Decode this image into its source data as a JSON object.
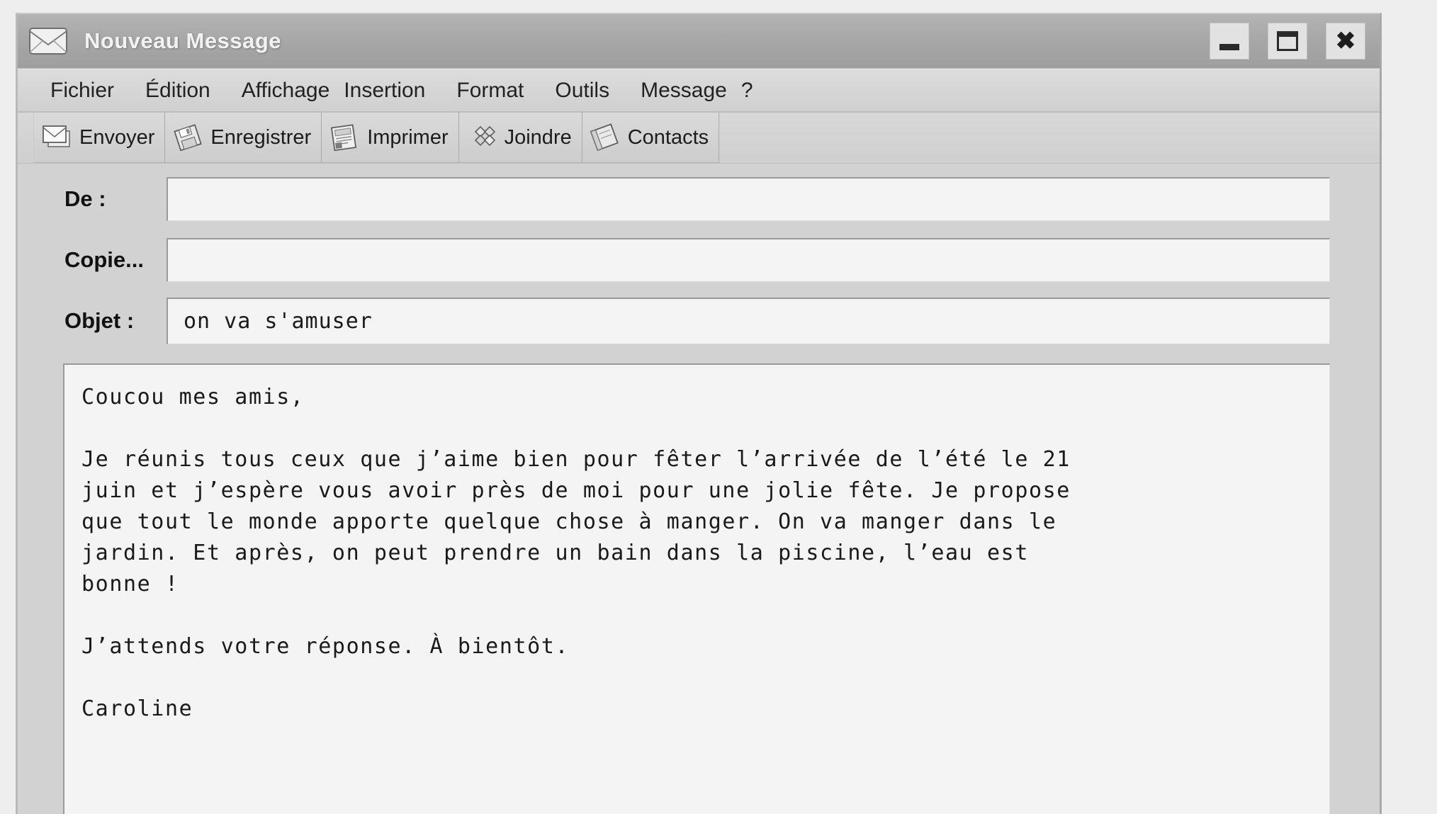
{
  "window": {
    "title": "Nouveau Message",
    "title_icon": "envelope-icon",
    "controls": {
      "minimize": "minimize-icon",
      "maximize": "maximize-icon",
      "close": "close-icon"
    }
  },
  "menubar": {
    "items": [
      {
        "label": "Fichier"
      },
      {
        "label": "Édition"
      },
      {
        "label": "Affichage"
      },
      {
        "label": "Insertion"
      },
      {
        "label": "Format"
      },
      {
        "label": "Outils"
      },
      {
        "label": "Message"
      },
      {
        "label": "?"
      }
    ]
  },
  "toolbar": {
    "buttons": [
      {
        "label": "Envoyer",
        "icon": "envelope-icon"
      },
      {
        "label": "Enregistrer",
        "icon": "floppy-disk-icon"
      },
      {
        "label": "Imprimer",
        "icon": "printer-icon"
      },
      {
        "label": "Joindre",
        "icon": "attach-clover-icon"
      },
      {
        "label": "Contacts",
        "icon": "address-book-icon"
      }
    ]
  },
  "form": {
    "from": {
      "label": "De :",
      "value": "",
      "placeholder": ""
    },
    "cc": {
      "label": "Copie...",
      "value": "",
      "placeholder": ""
    },
    "subject": {
      "label": "Objet :",
      "value": "on va s'amuser",
      "placeholder": ""
    }
  },
  "message": {
    "body": "Coucou mes amis,\n\nJe réunis tous ceux que j’aime bien pour fêter l’arrivée de l’été le 21\njuin et j’espère vous avoir près de moi pour une jolie fête. Je propose\nque tout le monde apporte quelque chose à manger. On va manger dans le\njardin. Et après, on peut prendre un bain dans la piscine, l’eau est\nbonne !\n\nJ’attends votre réponse. À bientôt.\n\nCaroline"
  },
  "colors": {
    "titlebar": "#a8a8a8",
    "window_face": "#d2d2d2",
    "field_bg": "#f4f4f4",
    "text": "#1a1a1a",
    "title_text": "#f2f2f2"
  }
}
